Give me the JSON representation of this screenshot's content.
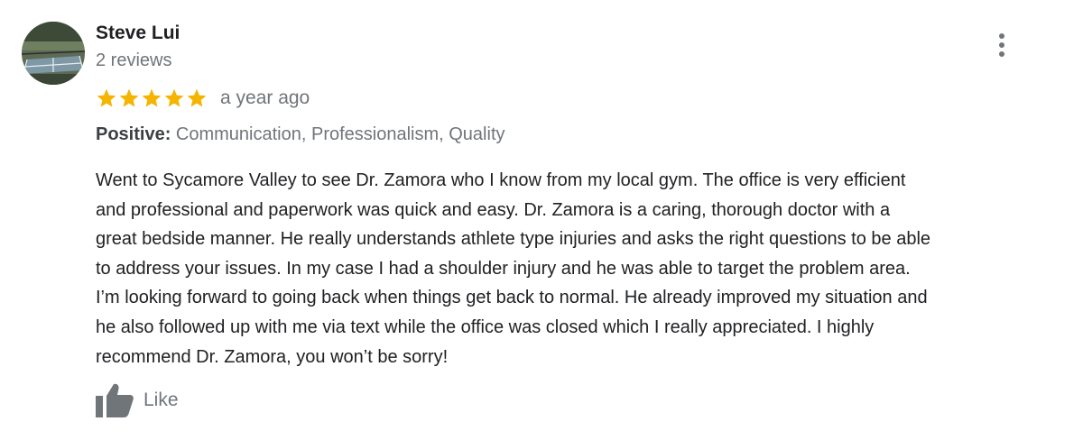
{
  "review": {
    "reviewer_name": "Steve Lui",
    "review_count": "2 reviews",
    "rating": 5,
    "rating_max": 5,
    "time_ago": "a year ago",
    "highlights_label": "Positive:",
    "highlights_value": " Communication, Professionalism, Quality",
    "text": "Went to Sycamore Valley to see Dr. Zamora who I know from my local gym.   The office is very efficient\nand professional and paperwork was quick and easy.  Dr. Zamora is a caring, thorough doctor with a\ngreat bedside manner. He really understands athlete type injuries and asks the right questions to be able\nto address your issues. In my case I had a shoulder injury and he was able to target the problem area.\nI’m looking forward to going back when things get back to normal. He already improved my situation and\nhe also followed up with me via text while the office was closed which I really appreciated.  I highly\nrecommend Dr. Zamora, you won’t be sorry!",
    "like_label": "Like"
  },
  "icons": {
    "star": "star-icon",
    "more": "more-vert-icon",
    "like": "thumbs-up-icon"
  },
  "colors": {
    "star": "#f4b400",
    "muted_text": "#70757a",
    "body_text": "#202124"
  }
}
